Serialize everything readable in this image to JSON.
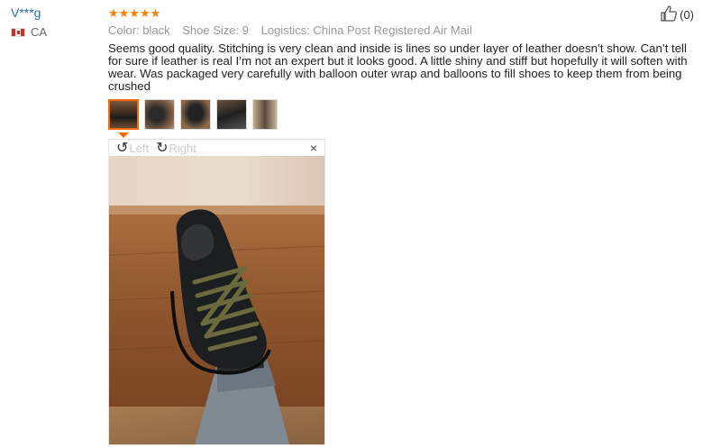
{
  "reviewer": {
    "name": "V***g",
    "country": "CA"
  },
  "review": {
    "stars": "★★★★★",
    "meta": {
      "color": "Color: black",
      "size": "Shoe Size: 9",
      "logistics": "Logistics: China Post Registered Air Mail"
    },
    "text": "Seems good quality. Stitching is very clean and inside is lines so under layer of leather doesn’t show. Can’t tell for sure if leather is real I’m not an expert but it looks good. A little shiny and stiff but hopefully it will soften with wear. Was packaged very carefully with balloon outer wrap and balloons to fill shoes to keep them from being crushed"
  },
  "helpful": {
    "count": "(0)",
    "icon": "thumbs-up-icon"
  },
  "viewer": {
    "rotate_left": "Left",
    "rotate_right": "Right",
    "close": "×",
    "icons": {
      "left": "rotate-left-icon",
      "right": "rotate-right-icon",
      "close": "close-icon"
    }
  },
  "colors": {
    "link": "#2a6ebb",
    "star": "#ff7e00",
    "active_border": "#ff6a00",
    "meta": "#999999"
  }
}
